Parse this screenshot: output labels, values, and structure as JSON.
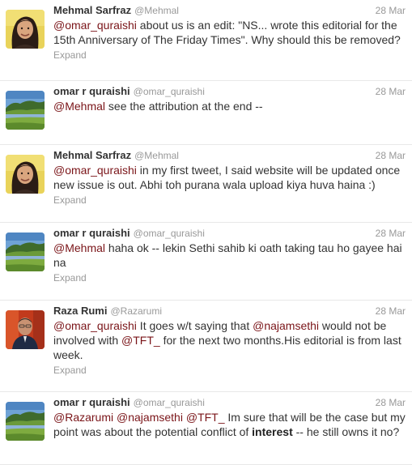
{
  "tweets": [
    {
      "name": "Mehmal Sarfraz",
      "handle": "@Mehmal",
      "time": "28 Mar",
      "avatar": "woman-portrait",
      "parts": [
        {
          "t": "@omar_quraishi",
          "k": "mention"
        },
        {
          "t": " about us is an edit: \"NS... wrote this editorial for the 15th Anniversary of The Friday Times\".  Why should this be removed?",
          "k": "text"
        }
      ],
      "expand": "Expand"
    },
    {
      "name": "omar r quraishi",
      "handle": "@omar_quraishi",
      "time": "28 Mar",
      "avatar": "landscape",
      "parts": [
        {
          "t": "@Mehmal",
          "k": "mention"
        },
        {
          "t": " see the attribution at the end --",
          "k": "text"
        }
      ]
    },
    {
      "name": "Mehmal Sarfraz",
      "handle": "@Mehmal",
      "time": "28 Mar",
      "avatar": "woman-portrait",
      "parts": [
        {
          "t": "@omar_quraishi",
          "k": "mention"
        },
        {
          "t": " in my first tweet, I said website will be updated once new issue is out. Abhi toh purana wala upload kiya huva haina :)",
          "k": "text"
        }
      ],
      "expand": "Expand"
    },
    {
      "name": "omar r quraishi",
      "handle": "@omar_quraishi",
      "time": "28 Mar",
      "avatar": "landscape",
      "parts": [
        {
          "t": "@Mehmal",
          "k": "mention"
        },
        {
          "t": " haha ok -- lekin Sethi sahib ki oath taking tau ho gayee hai na",
          "k": "text"
        }
      ],
      "expand": "Expand"
    },
    {
      "name": "Raza Rumi",
      "handle": "@Razarumi",
      "time": "28 Mar",
      "avatar": "man-portrait",
      "parts": [
        {
          "t": "@omar_quraishi",
          "k": "mention"
        },
        {
          "t": " It goes w/t saying that ",
          "k": "text"
        },
        {
          "t": "@najamsethi",
          "k": "mention"
        },
        {
          "t": " would not be involved with ",
          "k": "text"
        },
        {
          "t": "@TFT_",
          "k": "mention"
        },
        {
          "t": " for the next two months.His editorial is from last week.",
          "k": "text"
        }
      ],
      "expand": "Expand"
    },
    {
      "name": "omar r quraishi",
      "handle": "@omar_quraishi",
      "time": "28 Mar",
      "avatar": "landscape",
      "parts": [
        {
          "t": "@Razarumi",
          "k": "mention"
        },
        {
          "t": " ",
          "k": "text"
        },
        {
          "t": "@najamsethi",
          "k": "mention"
        },
        {
          "t": " ",
          "k": "text"
        },
        {
          "t": "@TFT_",
          "k": "mention"
        },
        {
          "t": " Im sure that will be the case but my point was about the potential conflict of ",
          "k": "text"
        },
        {
          "t": "interest",
          "k": "bold"
        },
        {
          "t": " -- he still owns it no?",
          "k": "text"
        }
      ]
    }
  ]
}
